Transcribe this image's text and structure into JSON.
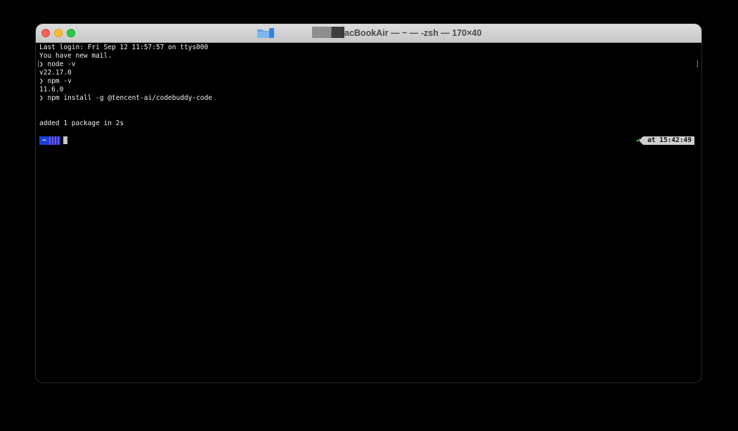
{
  "window": {
    "title": "acBookAir — ~ — -zsh — 170×40",
    "folder_icon": "folder-icon"
  },
  "terminal": {
    "lines": [
      {
        "type": "text",
        "text": "Last login: Fri Sep 12 11:57:57 on ttys000"
      },
      {
        "type": "text",
        "text": "You have new mail."
      },
      {
        "type": "prompt",
        "arrow": "❯",
        "text": "node -v",
        "bracket_left": "[",
        "bracket_right": "]"
      },
      {
        "type": "text",
        "text": "v22.17.0"
      },
      {
        "type": "prompt",
        "arrow": "❯",
        "text": "npm -v"
      },
      {
        "type": "text",
        "text": "11.6.0"
      },
      {
        "type": "prompt",
        "arrow": "❯",
        "text": "npm install -g @tencent-ai/codebuddy-code"
      },
      {
        "type": "text",
        "text": ""
      },
      {
        "type": "text",
        "text": ""
      },
      {
        "type": "text",
        "text": "added 1 package in 2s"
      },
      {
        "type": "text",
        "text": ""
      }
    ],
    "ps1": {
      "home": "~",
      "status_check": "✔",
      "time_label": "at 15:42:49"
    }
  },
  "colors": {
    "close": "#fe5f57",
    "minimize": "#febc2e",
    "zoom": "#28c840",
    "home_segment": "#1a3fd8",
    "check": "#5fd35f"
  }
}
